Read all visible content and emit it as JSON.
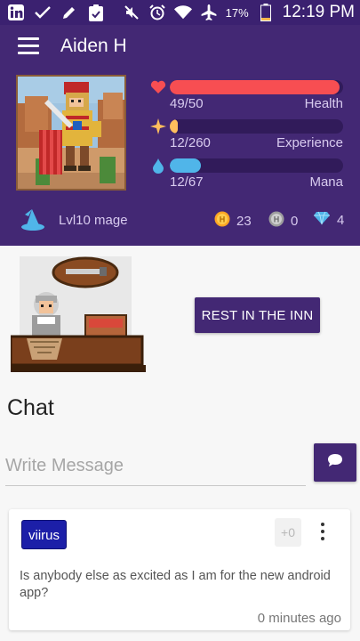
{
  "status_bar": {
    "left_icons": [
      "linkedin-icon",
      "check-icon",
      "pencil-icon",
      "clipboard-icon"
    ],
    "right_icons": [
      "mute-icon",
      "alarm-icon",
      "wifi-icon",
      "airplane-icon",
      "battery-icon"
    ],
    "battery": "17%",
    "time": "12:19 PM"
  },
  "header": {
    "menu_icon": "hamburger-icon",
    "username": "Aiden H",
    "stats": [
      {
        "icon": "heart-icon",
        "value": "49/50",
        "label": "Health",
        "fraction": 0.98,
        "color": "#f74e52"
      },
      {
        "icon": "star-icon",
        "value": "12/260",
        "label": "Experience",
        "fraction": 0.046,
        "color": "#ffbe5d"
      },
      {
        "icon": "droplet-icon",
        "value": "12/67",
        "label": "Mana",
        "fraction": 0.18,
        "color": "#50b5e9"
      }
    ],
    "class_icon": "wizard-hat-icon",
    "class_label": "Lvl10 mage",
    "currencies": [
      {
        "icon": "gold-coin-icon",
        "value": "23"
      },
      {
        "icon": "silver-coin-icon",
        "value": "0"
      },
      {
        "icon": "gem-icon",
        "value": "4"
      }
    ]
  },
  "inn": {
    "rest_button": "REST IN THE INN"
  },
  "chat": {
    "title": "Chat",
    "input_placeholder": "Write Message",
    "input_value": "",
    "send_icon": "chat-bubble-icon",
    "messages": [
      {
        "user": "viirus",
        "likes": "+0",
        "text": "Is anybody else as excited as I am for the new android app?",
        "time": "0 minutes ago"
      }
    ]
  },
  "colors": {
    "primary": "#432874",
    "status_bar": "#3b2170",
    "health": "#f74e52",
    "experience": "#ffbe5d",
    "mana": "#50b5e9",
    "user_badge": "#1c1fa8"
  }
}
